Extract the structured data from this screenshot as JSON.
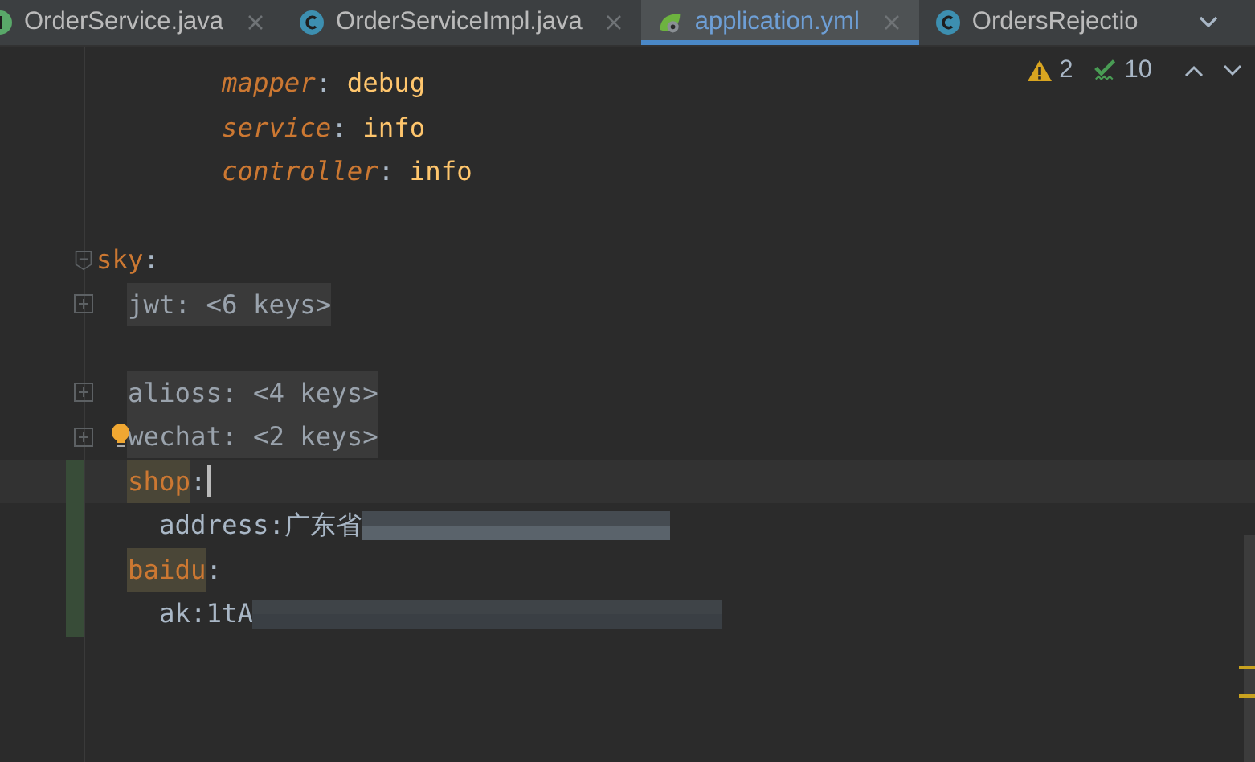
{
  "tabs": [
    {
      "label": "OrderService.java",
      "kind": "interface",
      "selected": false,
      "closable": true
    },
    {
      "label": "OrderServiceImpl.java",
      "kind": "class",
      "selected": false,
      "closable": true
    },
    {
      "label": "application.yml",
      "kind": "config",
      "selected": true,
      "closable": true
    },
    {
      "label": "OrdersRejectio",
      "kind": "class",
      "selected": false,
      "closable": false
    }
  ],
  "inspections": {
    "warnings": "2",
    "weak_warnings": "10"
  },
  "lines": [
    {
      "kind": "partial_block",
      "children": [
        {
          "kind": "pair",
          "key": "mapper",
          "colon": ":",
          "value": "debug"
        },
        {
          "kind": "pair",
          "key": "service",
          "colon": ":",
          "value": "info"
        },
        {
          "kind": "pair",
          "key": "controller",
          "colon": ":",
          "value": "info"
        }
      ]
    },
    {
      "kind": "blank"
    },
    {
      "kind": "key",
      "key": "sky",
      "colon": ":",
      "highlight": false,
      "changed": false,
      "caret": false,
      "children": [
        {
          "kind": "folded",
          "text": "jwt: <6 keys>",
          "bulb": false
        },
        {
          "kind": "blank"
        },
        {
          "kind": "folded",
          "text": "alioss: <4 keys>",
          "bulb": false
        },
        {
          "kind": "folded",
          "text": "wechat: <2 keys>",
          "bulb": true
        },
        {
          "kind": "key",
          "key": "shop",
          "colon": ":",
          "highlight": true,
          "changed": true,
          "caret": true,
          "children": [
            {
              "kind": "text",
              "text": "address:广东省",
              "redacted": true,
              "changed": true
            }
          ]
        },
        {
          "kind": "key",
          "key": "baidu",
          "colon": ":",
          "highlight": true,
          "changed": true,
          "caret": false,
          "children": [
            {
              "kind": "text",
              "text": "ak:1tA",
              "redacted": true,
              "changed": true
            }
          ]
        },
        {
          "kind": "blank"
        }
      ]
    }
  ]
}
